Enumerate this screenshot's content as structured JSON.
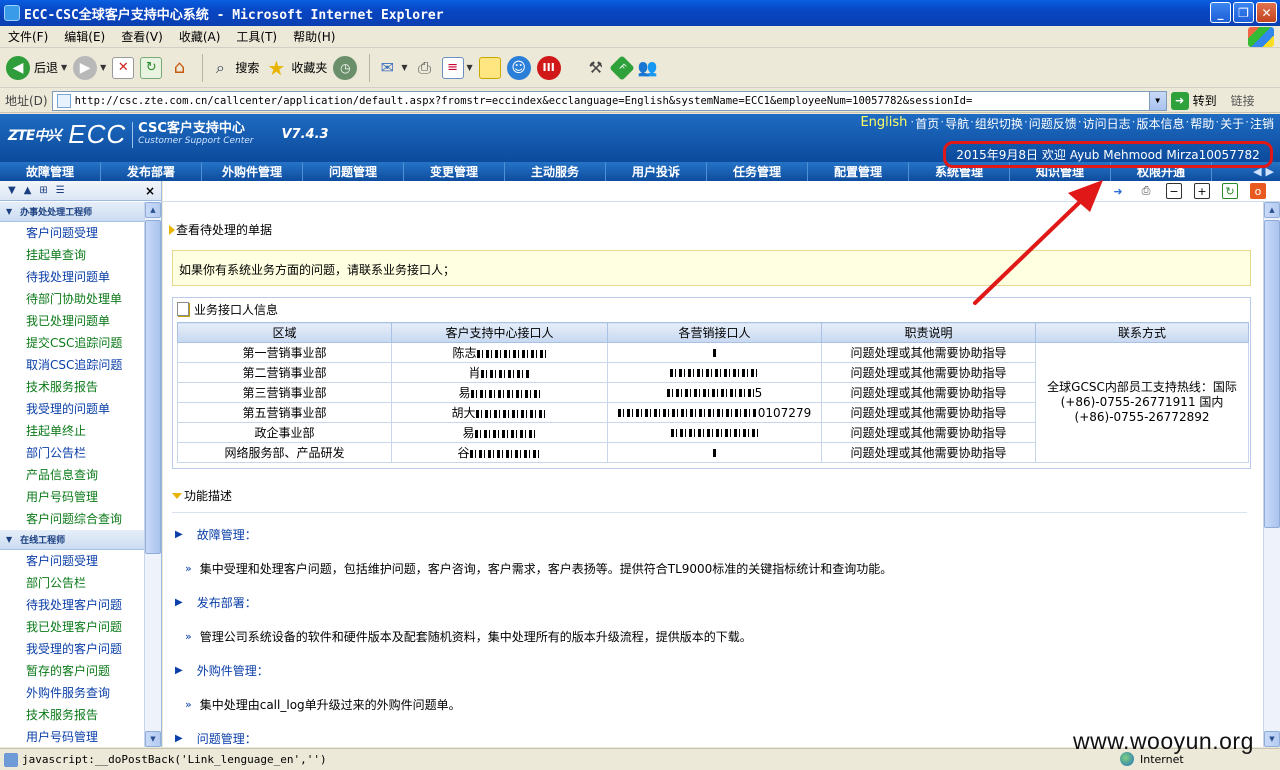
{
  "window": {
    "title": "ECC-CSC全球客户支持中心系统 - Microsoft Internet Explorer",
    "minimize": "_",
    "restore": "❐",
    "close": "✕"
  },
  "menubar": [
    "文件(F)",
    "编辑(E)",
    "查看(V)",
    "收藏(A)",
    "工具(T)",
    "帮助(H)"
  ],
  "toolbar": {
    "back": "后退",
    "search": "搜索",
    "favorites": "收藏夹"
  },
  "address": {
    "label": "地址(D)",
    "url": "http://csc.zte.com.cn/callcenter/application/default.aspx?fromstr=eccindex&ecclanguage=English&systemName=ECC1&employeeNum=10057782&sessionId=",
    "go": "转到",
    "links": "链接"
  },
  "header": {
    "zte": "ZTE中兴",
    "ecc": "ECC",
    "csc_name": "CSC客户支持中心",
    "csc_en": "Customer Support Center",
    "version": "V7.4.3",
    "lang_link": "English",
    "top_links": [
      "首页",
      "导航",
      "组织切换",
      "问题反馈",
      "访问日志",
      "版本信息",
      "帮助",
      "关于",
      "注销"
    ],
    "welcome": "2015年9月8日 欢迎 Ayub Mehmood Mirza10057782"
  },
  "navtabs": [
    "故障管理",
    "发布部署",
    "外购件管理",
    "问题管理",
    "变更管理",
    "主动服务",
    "用户投诉",
    "任务管理",
    "配置管理",
    "系统管理",
    "知识管理",
    "权限开通"
  ],
  "sidebar": {
    "close": "×",
    "groups": [
      {
        "title": "办事处处理工程师",
        "items": [
          "客户问题受理",
          "挂起单查询",
          "待我处理问题单",
          "待部门协助处理单",
          "我已处理问题单",
          "提交CSC追踪问题",
          "取消CSC追踪问题",
          "技术服务报告",
          "我受理的问题单",
          "挂起单终止",
          "部门公告栏",
          "产品信息查询",
          "用户号码管理",
          "客户问题综合查询"
        ]
      },
      {
        "title": "在线工程师",
        "items": [
          "客户问题受理",
          "部门公告栏",
          "待我处理客户问题",
          "我已处理客户问题",
          "我受理的客户问题",
          "暂存的客户问题",
          "外购件服务查询",
          "技术服务报告",
          "用户号码管理"
        ]
      }
    ]
  },
  "content": {
    "pending_title": "查看待处理的单据",
    "notice": "如果你有系统业务方面的问题，请联系业务接口人；",
    "contacts_title": "业务接口人信息",
    "table": {
      "headers": [
        "区域",
        "客户支持中心接口人",
        "各营销接口人",
        "职责说明",
        "联系方式"
      ],
      "rows": [
        [
          "第一营销事业部",
          "陈志",
          "",
          "问题处理或其他需要协助指导"
        ],
        [
          "第二营销事业部",
          "肖",
          "",
          "问题处理或其他需要协助指导"
        ],
        [
          "第三营销事业部",
          "易",
          "5",
          "问题处理或其他需要协助指导"
        ],
        [
          "第五营销事业部",
          "胡大",
          "0107279",
          "问题处理或其他需要协助指导"
        ],
        [
          "政企事业部",
          "易",
          "",
          "问题处理或其他需要协助指导"
        ],
        [
          "网络服务部、产品研发",
          "谷",
          "",
          "问题处理或其他需要协助指导"
        ]
      ],
      "contact_method": "全球GCSC内部员工支持热线：国际(+86)-0755-26771911 国内(+86)-0755-26772892"
    },
    "func_title": "功能描述",
    "functions": [
      {
        "name": "故障管理：",
        "desc": "集中受理和处理客户问题，包括维护问题，客户咨询，客户需求，客户表扬等。提供符合TL9000标准的关键指标统计和查询功能。"
      },
      {
        "name": "发布部署：",
        "desc": "管理公司系统设备的软件和硬件版本及配套随机资料，集中处理所有的版本升级流程，提供版本的下载。"
      },
      {
        "name": "外购件管理：",
        "desc": "集中处理由call_log单升级过来的外购件问题单。"
      },
      {
        "name": "问题管理：",
        "desc": ""
      }
    ]
  },
  "statusbar": {
    "text": "javascript:__doPostBack('Link_lenguage_en','')",
    "zone": "Internet"
  },
  "watermark": "www.wooyun.org",
  "colors": {
    "header_blue": "#0c4a9c",
    "annotation_red": "#e01818",
    "sidebar_green": "#0b7a18",
    "link_blue": "#0a3ea8"
  }
}
